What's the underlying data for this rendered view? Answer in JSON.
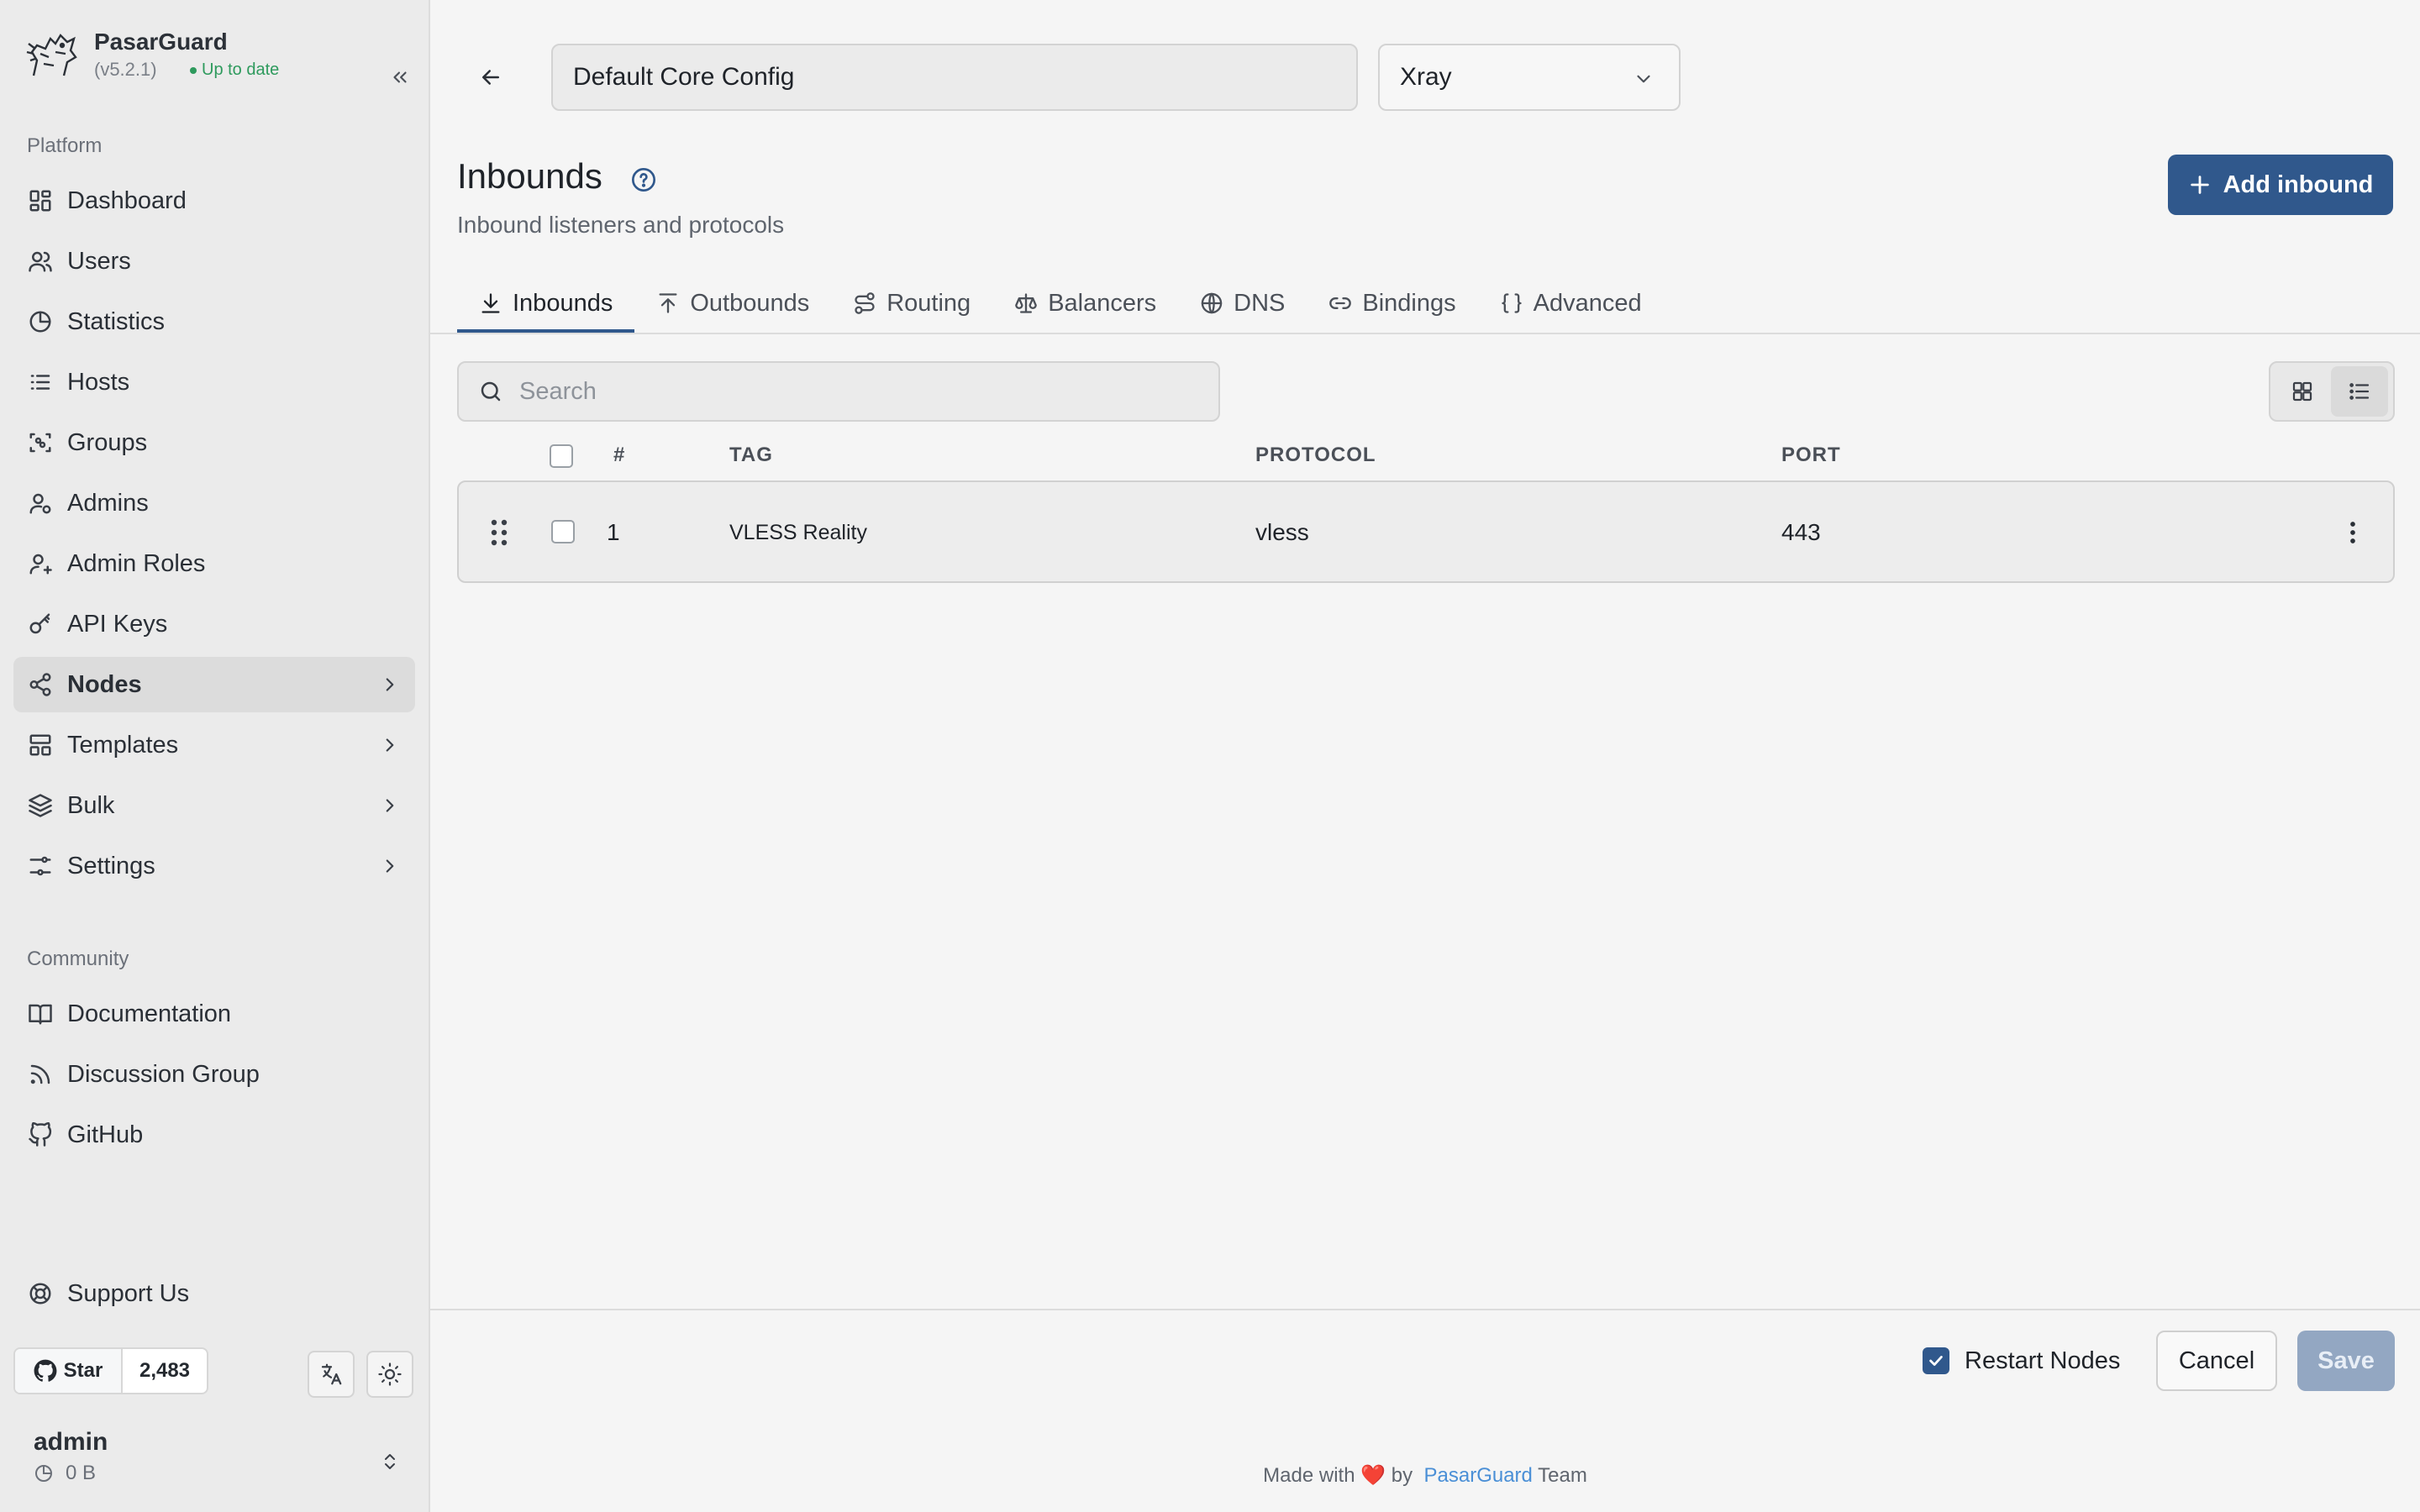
{
  "brand": {
    "name": "PasarGuard",
    "version": "(v5.2.1)",
    "status": "Up to date"
  },
  "sidebar": {
    "platform_label": "Platform",
    "platform_items": [
      {
        "label": "Dashboard",
        "icon": "dashboard-icon"
      },
      {
        "label": "Users",
        "icon": "users-icon"
      },
      {
        "label": "Statistics",
        "icon": "pie-chart-icon"
      },
      {
        "label": "Hosts",
        "icon": "list-icon"
      },
      {
        "label": "Groups",
        "icon": "group-icon"
      },
      {
        "label": "Admins",
        "icon": "admin-icon"
      },
      {
        "label": "Admin Roles",
        "icon": "admin-roles-icon"
      },
      {
        "label": "API Keys",
        "icon": "key-icon"
      },
      {
        "label": "Nodes",
        "icon": "share-nodes-icon",
        "active": true,
        "chevron": true
      },
      {
        "label": "Templates",
        "icon": "template-icon",
        "chevron": true
      },
      {
        "label": "Bulk",
        "icon": "layers-icon",
        "chevron": true
      },
      {
        "label": "Settings",
        "icon": "settings-sliders-icon",
        "chevron": true
      }
    ],
    "community_label": "Community",
    "community_items": [
      {
        "label": "Documentation",
        "icon": "book-icon"
      },
      {
        "label": "Discussion Group",
        "icon": "rss-icon"
      },
      {
        "label": "GitHub",
        "icon": "github-icon"
      }
    ],
    "support_label": "Support Us",
    "star_label": "Star",
    "star_count": "2,483",
    "user": {
      "name": "admin",
      "usage": "0 B"
    }
  },
  "header": {
    "config_name": "Default Core Config",
    "core_type": "Xray"
  },
  "page": {
    "title": "Inbounds",
    "subtitle": "Inbound listeners and protocols",
    "add_button": "Add inbound"
  },
  "tabs": [
    {
      "label": "Inbounds",
      "icon": "download-icon",
      "active": true
    },
    {
      "label": "Outbounds",
      "icon": "upload-icon"
    },
    {
      "label": "Routing",
      "icon": "route-icon"
    },
    {
      "label": "Balancers",
      "icon": "scale-icon"
    },
    {
      "label": "DNS",
      "icon": "globe-icon"
    },
    {
      "label": "Bindings",
      "icon": "link-icon"
    },
    {
      "label": "Advanced",
      "icon": "braces-icon"
    }
  ],
  "search": {
    "placeholder": "Search",
    "value": ""
  },
  "table": {
    "columns": [
      "#",
      "TAG",
      "PROTOCOL",
      "PORT"
    ],
    "rows": [
      {
        "index": "1",
        "tag": "VLESS Reality",
        "protocol": "vless",
        "port": "443"
      }
    ]
  },
  "footer": {
    "restart_label": "Restart Nodes",
    "restart_checked": true,
    "cancel_label": "Cancel",
    "save_label": "Save",
    "credit_prefix": "Made with",
    "credit_heart": "❤️",
    "credit_by": "by",
    "credit_brand": "PasarGuard",
    "credit_suffix": "Team"
  },
  "colors": {
    "accent": "#30588c",
    "status_ok": "#2e9a5d",
    "link": "#4a8fd6"
  }
}
